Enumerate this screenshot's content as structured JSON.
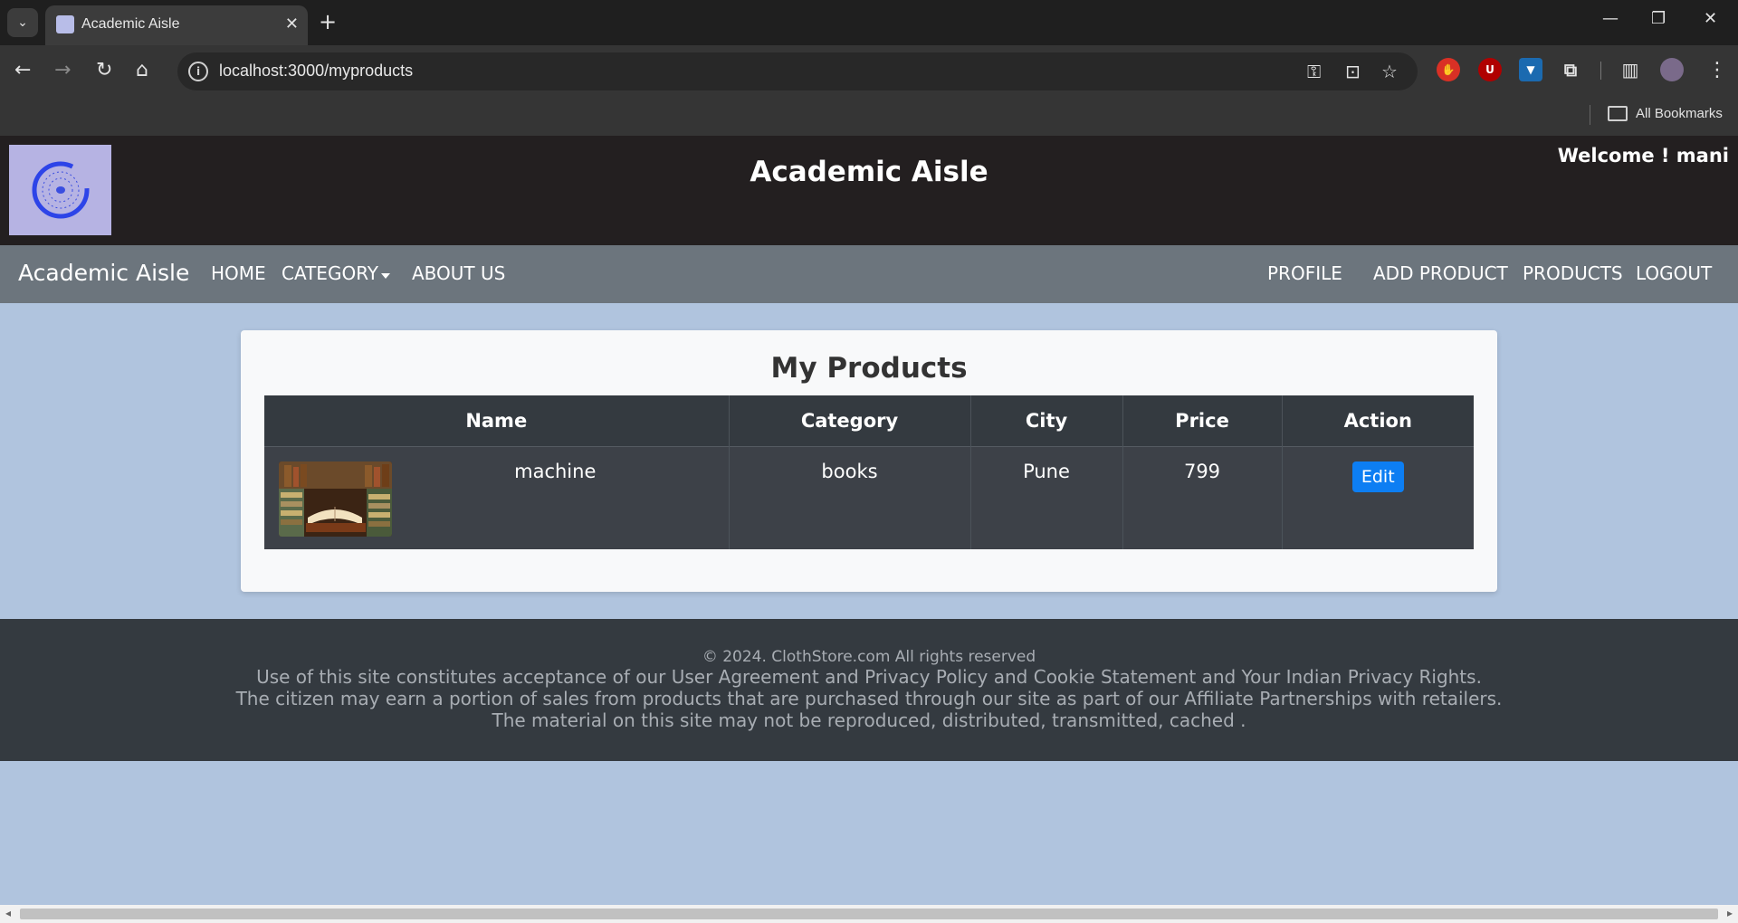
{
  "browser": {
    "tab_title": "Academic Aisle",
    "url": "localhost:3000/myproducts",
    "bookmarks_label": "All Bookmarks"
  },
  "header": {
    "title": "Academic Aisle",
    "welcome": "Welcome ! mani"
  },
  "navbar": {
    "brand": "Academic Aisle",
    "left": [
      "HOME",
      "CATEGORY",
      "ABOUT US"
    ],
    "right": [
      "PROFILE",
      "ADD PRODUCT",
      "PRODUCTS",
      "LOGOUT"
    ]
  },
  "main": {
    "title": "My Products",
    "table": {
      "headers": [
        "Name",
        "Category",
        "City",
        "Price",
        "Action"
      ],
      "rows": [
        {
          "name": "machine",
          "category": "books",
          "city": "Pune",
          "price": "799",
          "action": "Edit"
        }
      ]
    }
  },
  "footer": {
    "copyright": "© 2024. ClothStore.com All rights reserved",
    "lines": [
      "Use of this site constitutes acceptance of our User Agreement and Privacy Policy and Cookie Statement and Your Indian Privacy Rights.",
      "The citizen may earn a portion of sales from products that are purchased through our site as part of our Affiliate Partnerships with retailers.",
      "The material on this site may not be reproduced, distributed, transmitted, cached ."
    ]
  },
  "colors": {
    "page_bg": "#b0c4de",
    "header_bg": "#231f20",
    "navbar_bg": "#6c757d",
    "table_header_bg": "#343a40",
    "edit_button": "#0d7ef3",
    "footer_bg": "#343a40"
  }
}
